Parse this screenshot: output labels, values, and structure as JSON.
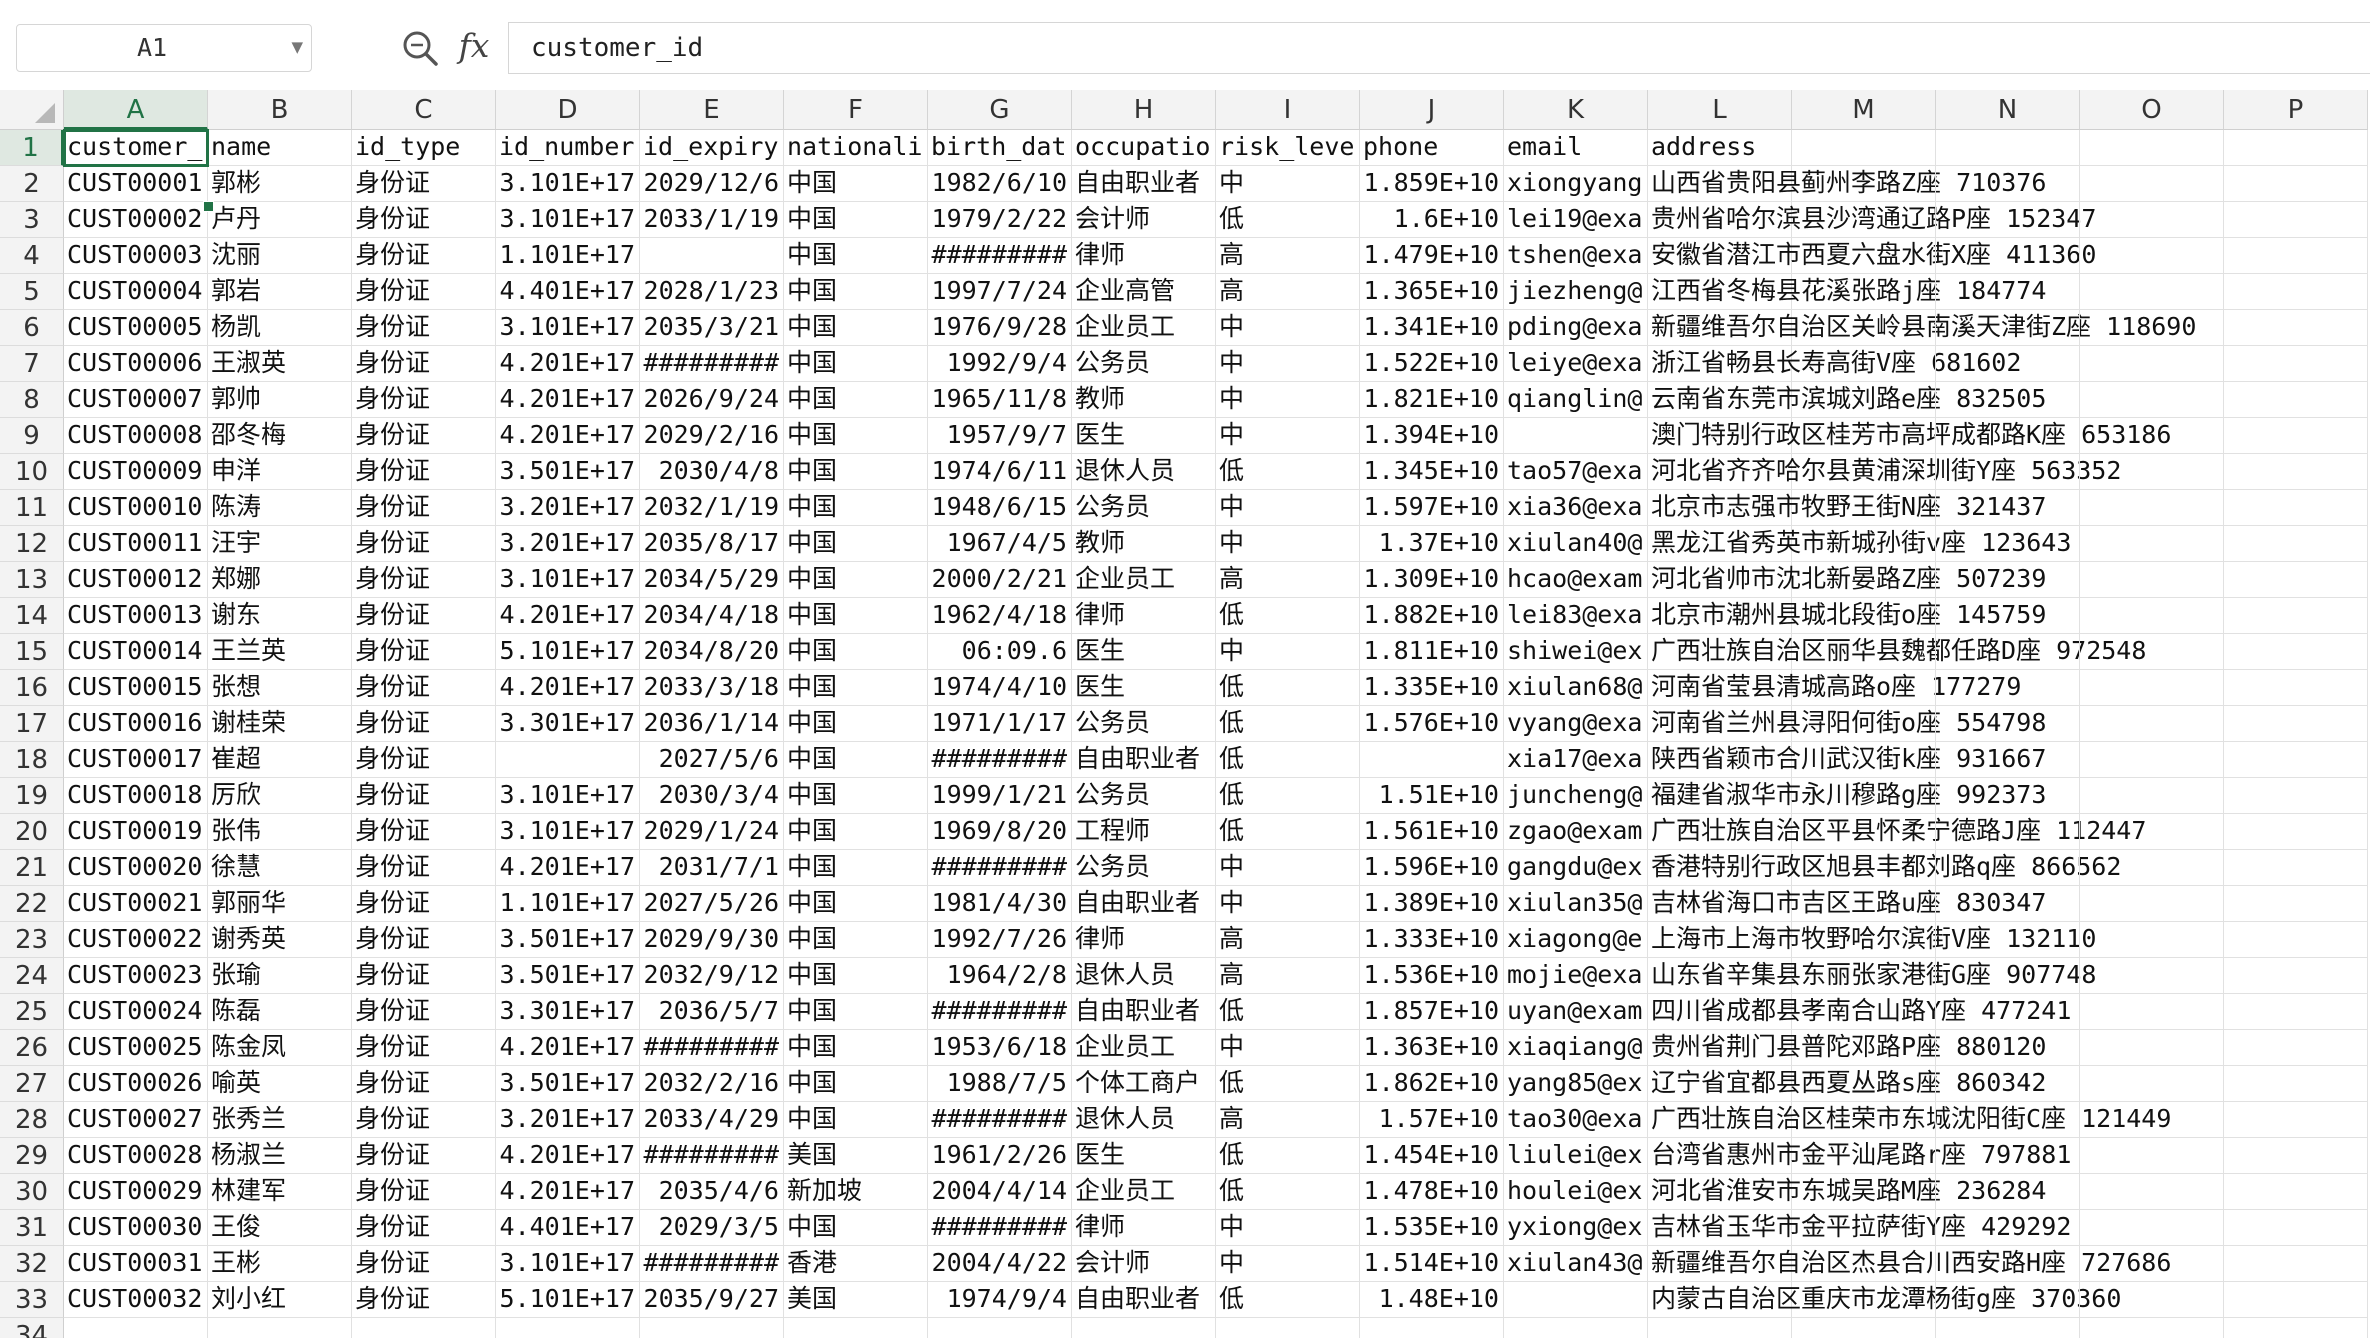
{
  "name_box": {
    "value": "A1"
  },
  "formula_bar": {
    "fx_label": "fx",
    "content": "customer_id"
  },
  "columns": [
    "A",
    "B",
    "C",
    "D",
    "E",
    "F",
    "G",
    "H",
    "I",
    "J",
    "K",
    "L",
    "M",
    "N",
    "O",
    "P"
  ],
  "selected": {
    "column": "A",
    "row": "1"
  },
  "row_numbers": [
    "1",
    "2",
    "3",
    "4",
    "5",
    "6",
    "7",
    "8",
    "9",
    "10",
    "11",
    "12",
    "13",
    "14",
    "15",
    "16",
    "17",
    "18",
    "19",
    "20",
    "21",
    "22",
    "23",
    "24",
    "25",
    "26",
    "27",
    "28",
    "29",
    "30",
    "31",
    "32",
    "33",
    "34"
  ],
  "header_row": [
    "customer_",
    "name",
    "id_type",
    "id_number",
    "id_expiry",
    "nationali",
    "birth_dat",
    "occupatio",
    "risk_leve",
    "phone",
    "email",
    "address"
  ],
  "rows": [
    [
      "CUST00001",
      "郭彬",
      "身份证",
      "3.101E+17",
      "2029/12/6",
      "中国",
      "1982/6/10",
      "自由职业者",
      "中",
      "1.859E+10",
      "xiongyang",
      "山西省贵阳县蓟州李路Z座 710376"
    ],
    [
      "CUST00002",
      "卢丹",
      "身份证",
      "3.101E+17",
      "2033/1/19",
      "中国",
      "1979/2/22",
      "会计师",
      "低",
      "1.6E+10",
      "lei19@exa",
      "贵州省哈尔滨县沙湾通辽路P座 152347"
    ],
    [
      "CUST00003",
      "沈丽",
      "身份证",
      "1.101E+17",
      "",
      "中国",
      "#########",
      "律师",
      "高",
      "1.479E+10",
      "tshen@exa",
      "安徽省潜江市西夏六盘水街X座 411360"
    ],
    [
      "CUST00004",
      "郭岩",
      "身份证",
      "4.401E+17",
      "2028/1/23",
      "中国",
      "1997/7/24",
      "企业高管",
      "高",
      "1.365E+10",
      "jiezheng@",
      "江西省冬梅县花溪张路j座 184774"
    ],
    [
      "CUST00005",
      "杨凯",
      "身份证",
      "3.101E+17",
      "2035/3/21",
      "中国",
      "1976/9/28",
      "企业员工",
      "中",
      "1.341E+10",
      "pding@exa",
      "新疆维吾尔自治区关岭县南溪天津街Z座 118690"
    ],
    [
      "CUST00006",
      "王淑英",
      "身份证",
      "4.201E+17",
      "#########",
      "中国",
      "1992/9/4",
      "公务员",
      "中",
      "1.522E+10",
      "leiye@exa",
      "浙江省畅县长寿高街V座 681602"
    ],
    [
      "CUST00007",
      "郭帅",
      "身份证",
      "4.201E+17",
      "2026/9/24",
      "中国",
      "1965/11/8",
      "教师",
      "中",
      "1.821E+10",
      "qianglin@",
      "云南省东莞市滨城刘路e座 832505"
    ],
    [
      "CUST00008",
      "邵冬梅",
      "身份证",
      "4.201E+17",
      "2029/2/16",
      "中国",
      "1957/9/7",
      "医生",
      "中",
      "1.394E+10",
      "",
      "澳门特别行政区桂芳市高坪成都路K座 653186"
    ],
    [
      "CUST00009",
      "申洋",
      "身份证",
      "3.501E+17",
      "2030/4/8",
      "中国",
      "1974/6/11",
      "退休人员",
      "低",
      "1.345E+10",
      "tao57@exa",
      "河北省齐齐哈尔县黄浦深圳街Y座 563352"
    ],
    [
      "CUST00010",
      "陈涛",
      "身份证",
      "3.201E+17",
      "2032/1/19",
      "中国",
      "1948/6/15",
      "公务员",
      "中",
      "1.597E+10",
      "xia36@exa",
      "北京市志强市牧野王街N座 321437"
    ],
    [
      "CUST00011",
      "汪宇",
      "身份证",
      "3.201E+17",
      "2035/8/17",
      "中国",
      "1967/4/5",
      "教师",
      "中",
      "1.37E+10",
      "xiulan40@",
      "黑龙江省秀英市新城孙街v座 123643"
    ],
    [
      "CUST00012",
      "郑娜",
      "身份证",
      "3.101E+17",
      "2034/5/29",
      "中国",
      "2000/2/21",
      "企业员工",
      "高",
      "1.309E+10",
      "hcao@exam",
      "河北省帅市沈北新晏路Z座 507239"
    ],
    [
      "CUST00013",
      "谢东",
      "身份证",
      "4.201E+17",
      "2034/4/18",
      "中国",
      "1962/4/18",
      "律师",
      "低",
      "1.882E+10",
      "lei83@exa",
      "北京市潮州县城北段街o座 145759"
    ],
    [
      "CUST00014",
      "王兰英",
      "身份证",
      "5.101E+17",
      "2034/8/20",
      "中国",
      "06:09.6",
      "医生",
      "中",
      "1.811E+10",
      "shiwei@ex",
      "广西壮族自治区丽华县魏都任路D座 972548"
    ],
    [
      "CUST00015",
      "张想",
      "身份证",
      "4.201E+17",
      "2033/3/18",
      "中国",
      "1974/4/10",
      "医生",
      "低",
      "1.335E+10",
      "xiulan68@",
      "河南省莹县清城高路o座 177279"
    ],
    [
      "CUST00016",
      "谢桂荣",
      "身份证",
      "3.301E+17",
      "2036/1/14",
      "中国",
      "1971/1/17",
      "公务员",
      "低",
      "1.576E+10",
      "vyang@exa",
      "河南省兰州县浔阳何街o座 554798"
    ],
    [
      "CUST00017",
      "崔超",
      "身份证",
      "",
      "2027/5/6",
      "中国",
      "#########",
      "自由职业者",
      "低",
      "",
      "xia17@exa",
      "陕西省颖市合川武汉街k座 931667"
    ],
    [
      "CUST00018",
      "厉欣",
      "身份证",
      "3.101E+17",
      "2030/3/4",
      "中国",
      "1999/1/21",
      "公务员",
      "低",
      "1.51E+10",
      "juncheng@",
      "福建省淑华市永川穆路g座 992373"
    ],
    [
      "CUST00019",
      "张伟",
      "身份证",
      "3.101E+17",
      "2029/1/24",
      "中国",
      "1969/8/20",
      "工程师",
      "低",
      "1.561E+10",
      "zgao@exam",
      "广西壮族自治区平县怀柔宁德路J座 112447"
    ],
    [
      "CUST00020",
      "徐慧",
      "身份证",
      "4.201E+17",
      "2031/7/1",
      "中国",
      "#########",
      "公务员",
      "中",
      "1.596E+10",
      "gangdu@ex",
      "香港特别行政区旭县丰都刘路q座 866562"
    ],
    [
      "CUST00021",
      "郭丽华",
      "身份证",
      "1.101E+17",
      "2027/5/26",
      "中国",
      "1981/4/30",
      "自由职业者",
      "中",
      "1.389E+10",
      "xiulan35@",
      "吉林省海口市吉区王路u座 830347"
    ],
    [
      "CUST00022",
      "谢秀英",
      "身份证",
      "3.501E+17",
      "2029/9/30",
      "中国",
      "1992/7/26",
      "律师",
      "高",
      "1.333E+10",
      "xiagong@e",
      "上海市上海市牧野哈尔滨街V座 132110"
    ],
    [
      "CUST00023",
      "张瑜",
      "身份证",
      "3.501E+17",
      "2032/9/12",
      "中国",
      "1964/2/8",
      "退休人员",
      "高",
      "1.536E+10",
      "mojie@exa",
      "山东省辛集县东丽张家港街G座 907748"
    ],
    [
      "CUST00024",
      "陈磊",
      "身份证",
      "3.301E+17",
      "2036/5/7",
      "中国",
      "#########",
      "自由职业者",
      "低",
      "1.857E+10",
      "uyan@exam",
      "四川省成都县孝南合山路Y座 477241"
    ],
    [
      "CUST00025",
      "陈金凤",
      "身份证",
      "4.201E+17",
      "#########",
      "中国",
      "1953/6/18",
      "企业员工",
      "中",
      "1.363E+10",
      "xiaqiang@",
      "贵州省荆门县普陀邓路P座 880120"
    ],
    [
      "CUST00026",
      "喻英",
      "身份证",
      "3.501E+17",
      "2032/2/16",
      "中国",
      "1988/7/5",
      "个体工商户",
      "低",
      "1.862E+10",
      "yang85@ex",
      "辽宁省宜都县西夏丛路s座 860342"
    ],
    [
      "CUST00027",
      "张秀兰",
      "身份证",
      "3.201E+17",
      "2033/4/29",
      "中国",
      "#########",
      "退休人员",
      "高",
      "1.57E+10",
      "tao30@exa",
      "广西壮族自治区桂荣市东城沈阳街C座 121449"
    ],
    [
      "CUST00028",
      "杨淑兰",
      "身份证",
      "4.201E+17",
      "#########",
      "美国",
      "1961/2/26",
      "医生",
      "低",
      "1.454E+10",
      "liulei@ex",
      "台湾省惠州市金平汕尾路r座 797881"
    ],
    [
      "CUST00029",
      "林建军",
      "身份证",
      "4.201E+17",
      "2035/4/6",
      "新加坡",
      "2004/4/14",
      "企业员工",
      "低",
      "1.478E+10",
      "houlei@ex",
      "河北省淮安市东城吴路M座 236284"
    ],
    [
      "CUST00030",
      "王俊",
      "身份证",
      "4.401E+17",
      "2029/3/5",
      "中国",
      "#########",
      "律师",
      "中",
      "1.535E+10",
      "yxiong@ex",
      "吉林省玉华市金平拉萨街Y座 429292"
    ],
    [
      "CUST00031",
      "王彬",
      "身份证",
      "3.101E+17",
      "#########",
      "香港",
      "2004/4/22",
      "会计师",
      "中",
      "1.514E+10",
      "xiulan43@",
      "新疆维吾尔自治区杰县合川西安路H座 727686"
    ],
    [
      "CUST00032",
      "刘小红",
      "身份证",
      "5.101E+17",
      "2035/9/27",
      "美国",
      "1974/9/4",
      "自由职业者",
      "低",
      "1.48E+10",
      "",
      "内蒙古自治区重庆市龙潭杨街g座 370360"
    ]
  ]
}
